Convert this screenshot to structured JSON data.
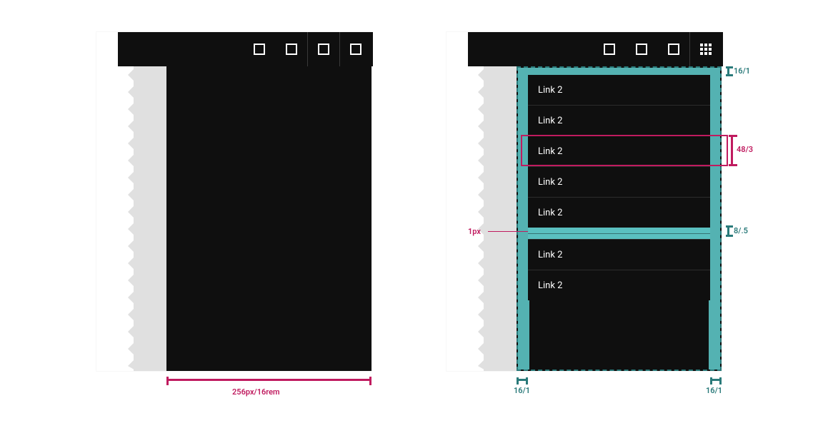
{
  "left": {
    "width_label": "256px/16rem"
  },
  "right": {
    "top_gap_label": "16/1",
    "row_height_label": "48/3",
    "divider_gap_label": "8/.5",
    "h_padding_left_label": "16/1",
    "h_padding_right_label": "16/1",
    "divider_rule_label": "1px",
    "menu": {
      "group1": [
        "Link 2",
        "Link 2",
        "Link 2",
        "Link 2",
        "Link 2"
      ],
      "group2": [
        "Link 2",
        "Link 2"
      ]
    }
  },
  "colors": {
    "teal": "#5ac0c0",
    "pink": "#c01b5f",
    "black": "#0f0f0f"
  }
}
